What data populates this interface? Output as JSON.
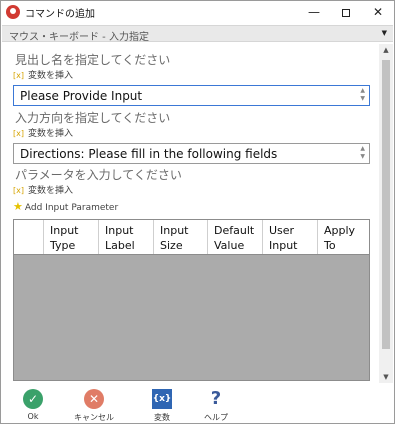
{
  "window": {
    "title": "コマンドの追加",
    "minimize": "—",
    "close": "✕"
  },
  "section": {
    "label": "マウス・キーボード - 入力指定"
  },
  "fields": [
    {
      "label": "見出し名を指定してください",
      "insert_var": "変数を挿入",
      "value": "Please Provide Input"
    },
    {
      "label": "入力方向を指定してください",
      "insert_var": "変数を挿入",
      "value": "Directions: Please fill in the following fields"
    }
  ],
  "params": {
    "label": "パラメータを入力してください",
    "insert_var": "変数を挿入",
    "add_label": "Add Input Parameter"
  },
  "table": {
    "columns": [
      {
        "line1": "",
        "line2": ""
      },
      {
        "line1": "Input",
        "line2": "Type"
      },
      {
        "line1": "Input",
        "line2": "Label"
      },
      {
        "line1": "Input",
        "line2": "Size"
      },
      {
        "line1": "Default",
        "line2": "Value"
      },
      {
        "line1": "User",
        "line2": "Input"
      },
      {
        "line1": "Apply",
        "line2": "To"
      }
    ],
    "rows": []
  },
  "footer": {
    "ok": "Ok",
    "cancel": "キャンセル",
    "variable": "変数",
    "help": "ヘルプ",
    "variable_icon_text": "{x}"
  },
  "colors": {
    "ok": "#3aa16a",
    "cancel": "#e07c66",
    "variable": "#2f66b3",
    "help": "#3a5a9a",
    "focus_border": "#3b78d6"
  }
}
